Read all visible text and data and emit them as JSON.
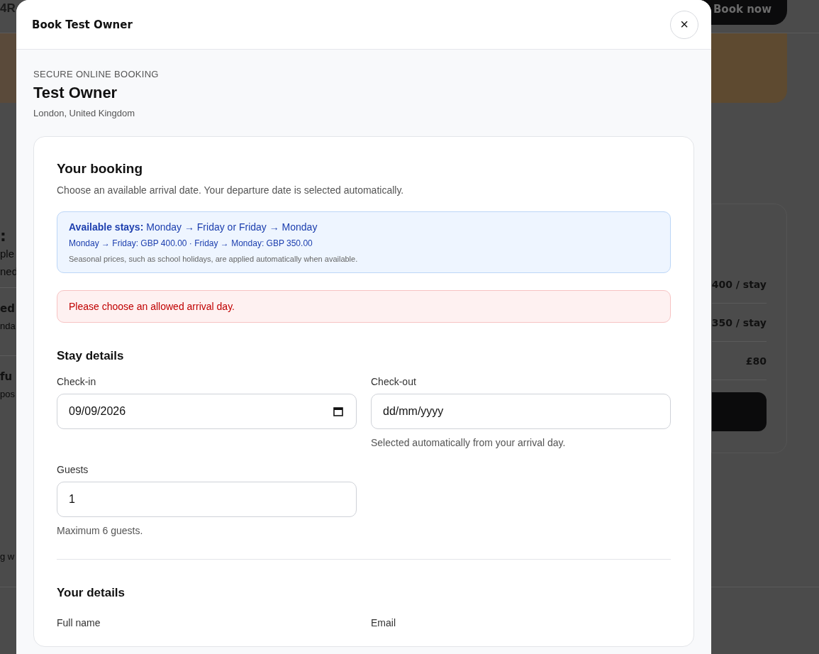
{
  "background_page": {
    "brand": "4R",
    "book_button": "Book now",
    "left_heading": ":",
    "left_lines": [
      "ple",
      "ned"
    ],
    "left_sections": [
      {
        "title": "ed",
        "text": "nda"
      },
      {
        "title": "fu",
        "text": "pos"
      }
    ],
    "left_footer": "g w",
    "price_rows": [
      "400 / stay",
      "350 / stay",
      "£80"
    ]
  },
  "modal": {
    "title": "Book Test Owner",
    "close": "×",
    "eyebrow": "SECURE ONLINE BOOKING",
    "owner_name": "Test Owner",
    "location": "London, United Kingdom",
    "booking": {
      "title": "Your booking",
      "description": "Choose an available arrival date. Your departure date is selected automatically.",
      "info": {
        "lead": "**Available stays:** Monday → Friday or Friday → Monday",
        "prices": "Monday → Friday: GBP 400.00 · Friday → Monday: GBP 350.00",
        "note": "Seasonal prices, such as school holidays, are applied automatically when available."
      },
      "error": "Please choose an allowed arrival day."
    },
    "stay_details": {
      "title": "Stay details",
      "fields": [
        {
          "kind": "date",
          "label": "Check-in",
          "value": "09/09/2026"
        },
        {
          "kind": "text",
          "label": "Check-out",
          "placeholder": "dd/mm/yyyy",
          "help": "Selected automatically from your arrival day."
        },
        {
          "kind": "text",
          "label": "Guests",
          "value": "1",
          "help": "Maximum 6 guests."
        }
      ]
    },
    "your_details": {
      "title": "Your details",
      "fields": [
        {
          "label": "Full name"
        },
        {
          "label": "Email"
        }
      ]
    }
  }
}
